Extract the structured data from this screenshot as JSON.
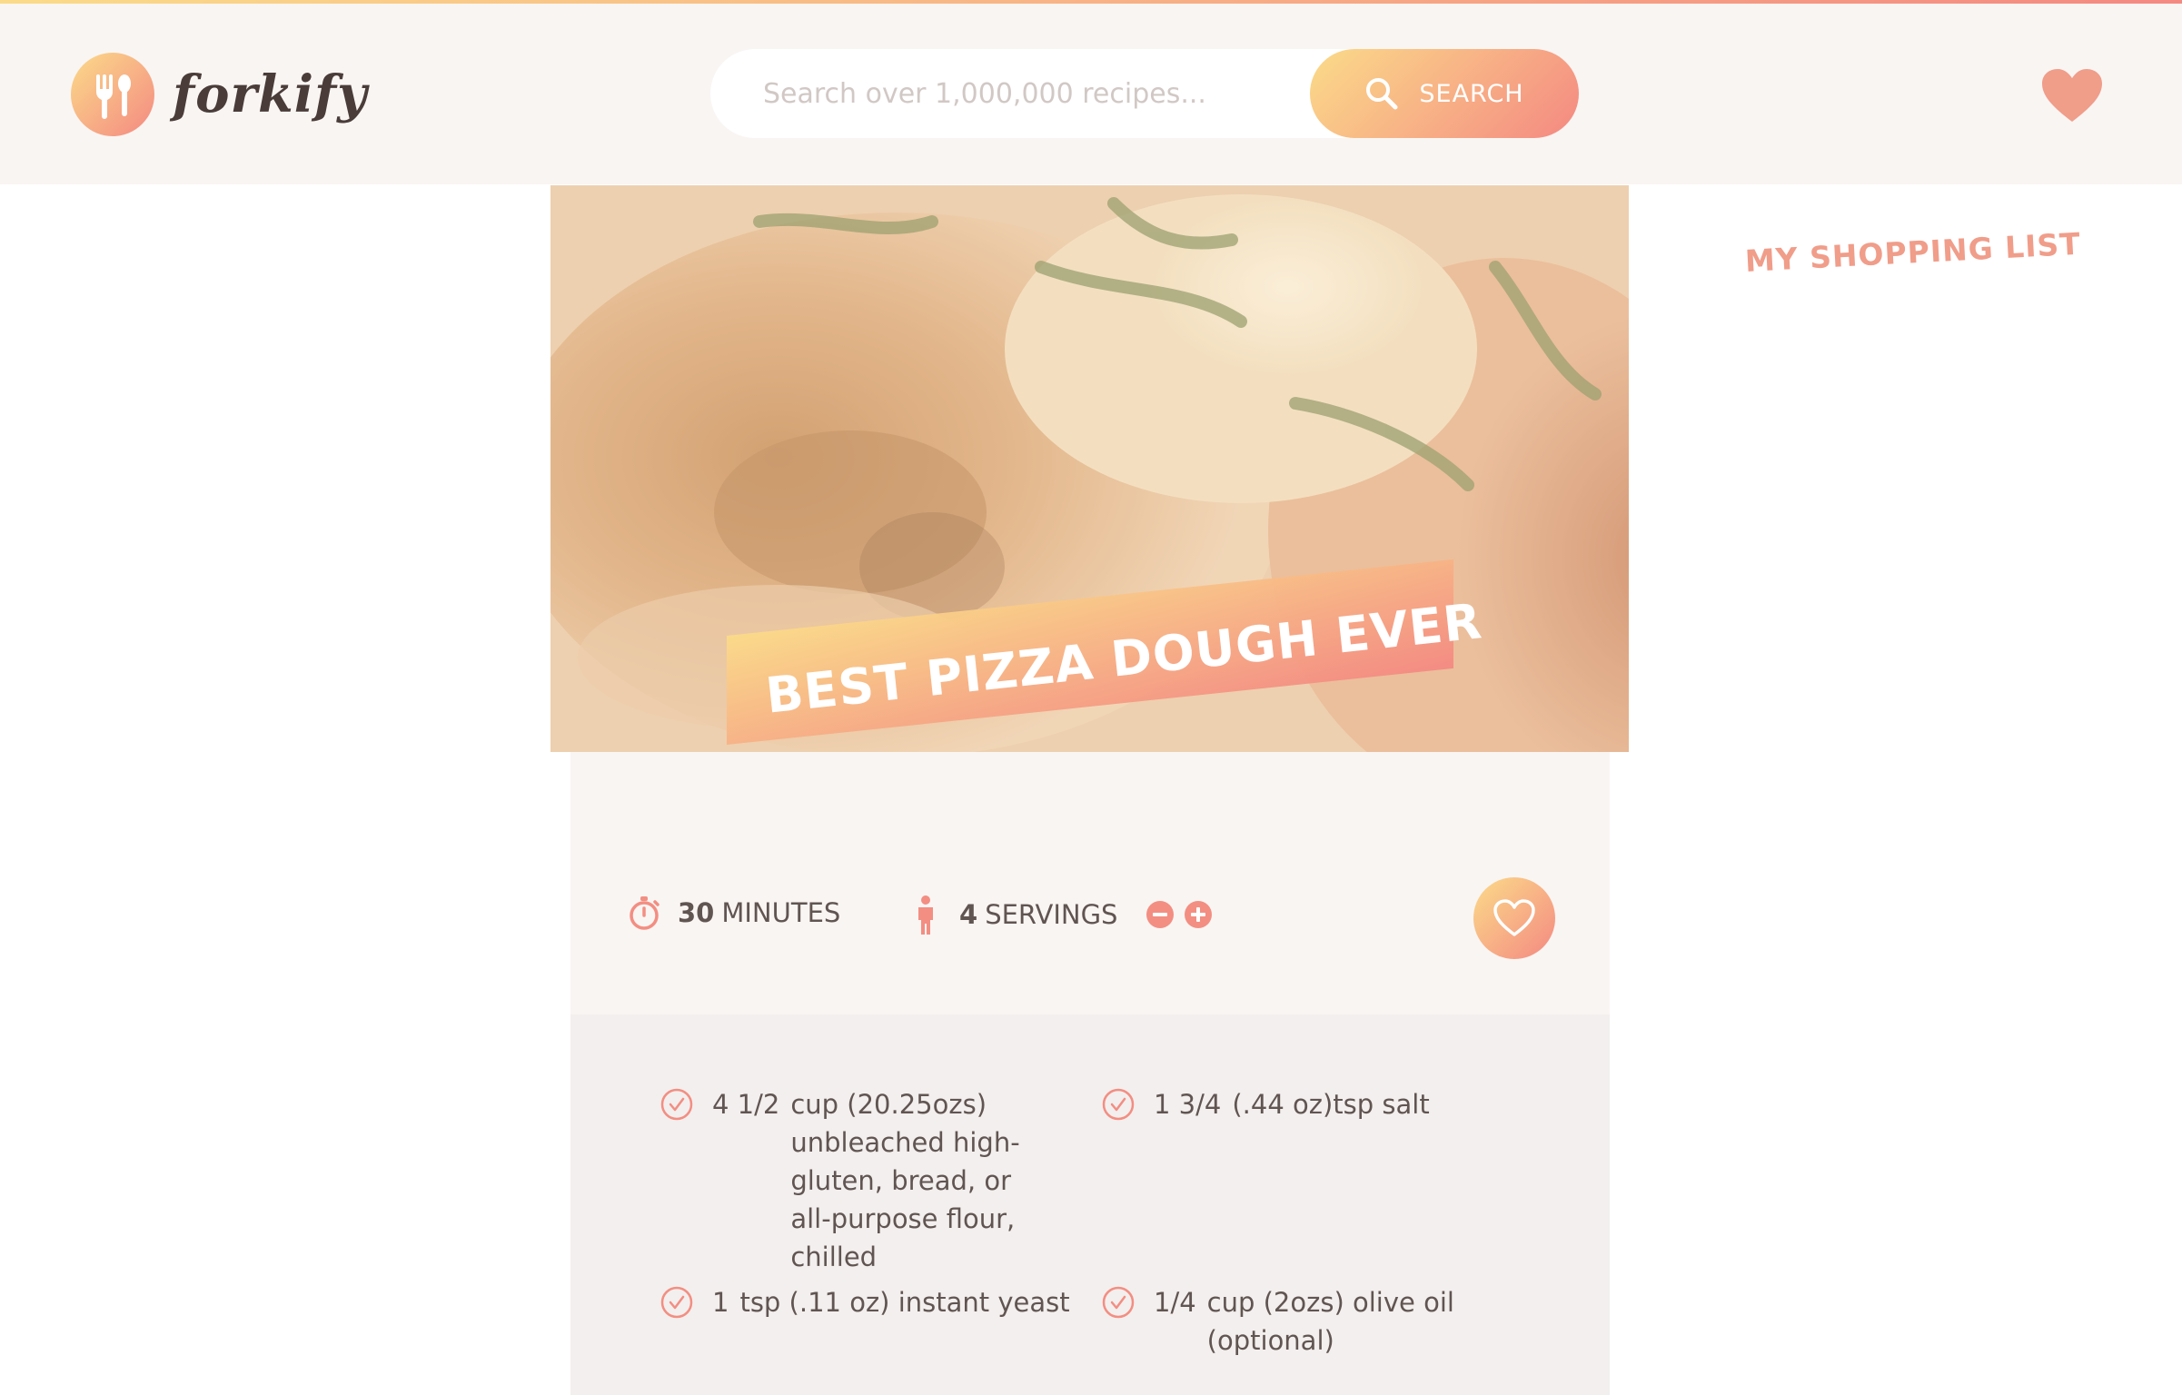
{
  "header": {
    "logo_text": "forkify",
    "search": {
      "placeholder": "Search over 1,000,000 recipes...",
      "button_label": "SEARCH"
    }
  },
  "recipe": {
    "title": "BEST PIZZA DOUGH EVER",
    "cooking_time": "30",
    "cooking_time_unit": "MINUTES",
    "servings": "4",
    "servings_unit": "SERVINGS",
    "ingredients": [
      {
        "qty": "4 1/2",
        "desc": "cup (20.25ozs) unbleached high-gluten, bread, or all-purpose flour, chilled"
      },
      {
        "qty": "1 3/4",
        "desc": "(.44 oz)tsp salt"
      },
      {
        "qty": "1",
        "desc": "tsp (.11 oz) instant yeast"
      },
      {
        "qty": "1/4",
        "desc": "cup (2ozs) olive oil (optional)"
      }
    ]
  },
  "shopping_list": {
    "title": "MY SHOPPING LIST"
  },
  "icons": {
    "logo": "fork-spoon-icon",
    "search": "search-icon",
    "likes": "heart-icon",
    "timer": "stopwatch-icon",
    "servings": "person-icon",
    "decrease": "minus-circle-icon",
    "increase": "plus-circle-icon",
    "bookmark": "heart-outline-icon",
    "ingredient": "check-circle-icon"
  },
  "colors": {
    "accent_start": "#fbdb89",
    "accent_end": "#f48982",
    "text": "#615551",
    "header_bg": "#f9f5f3"
  }
}
